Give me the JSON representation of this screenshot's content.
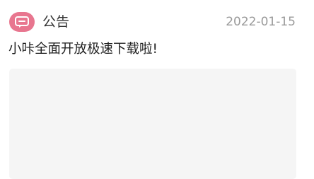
{
  "notice": {
    "title": "公告",
    "date": "2022-01-15",
    "message": "小咔全面开放极速下载啦!",
    "icon": "message-icon",
    "accent_color": "#e8768f",
    "image_placeholder_color": "#f5f5f5"
  }
}
